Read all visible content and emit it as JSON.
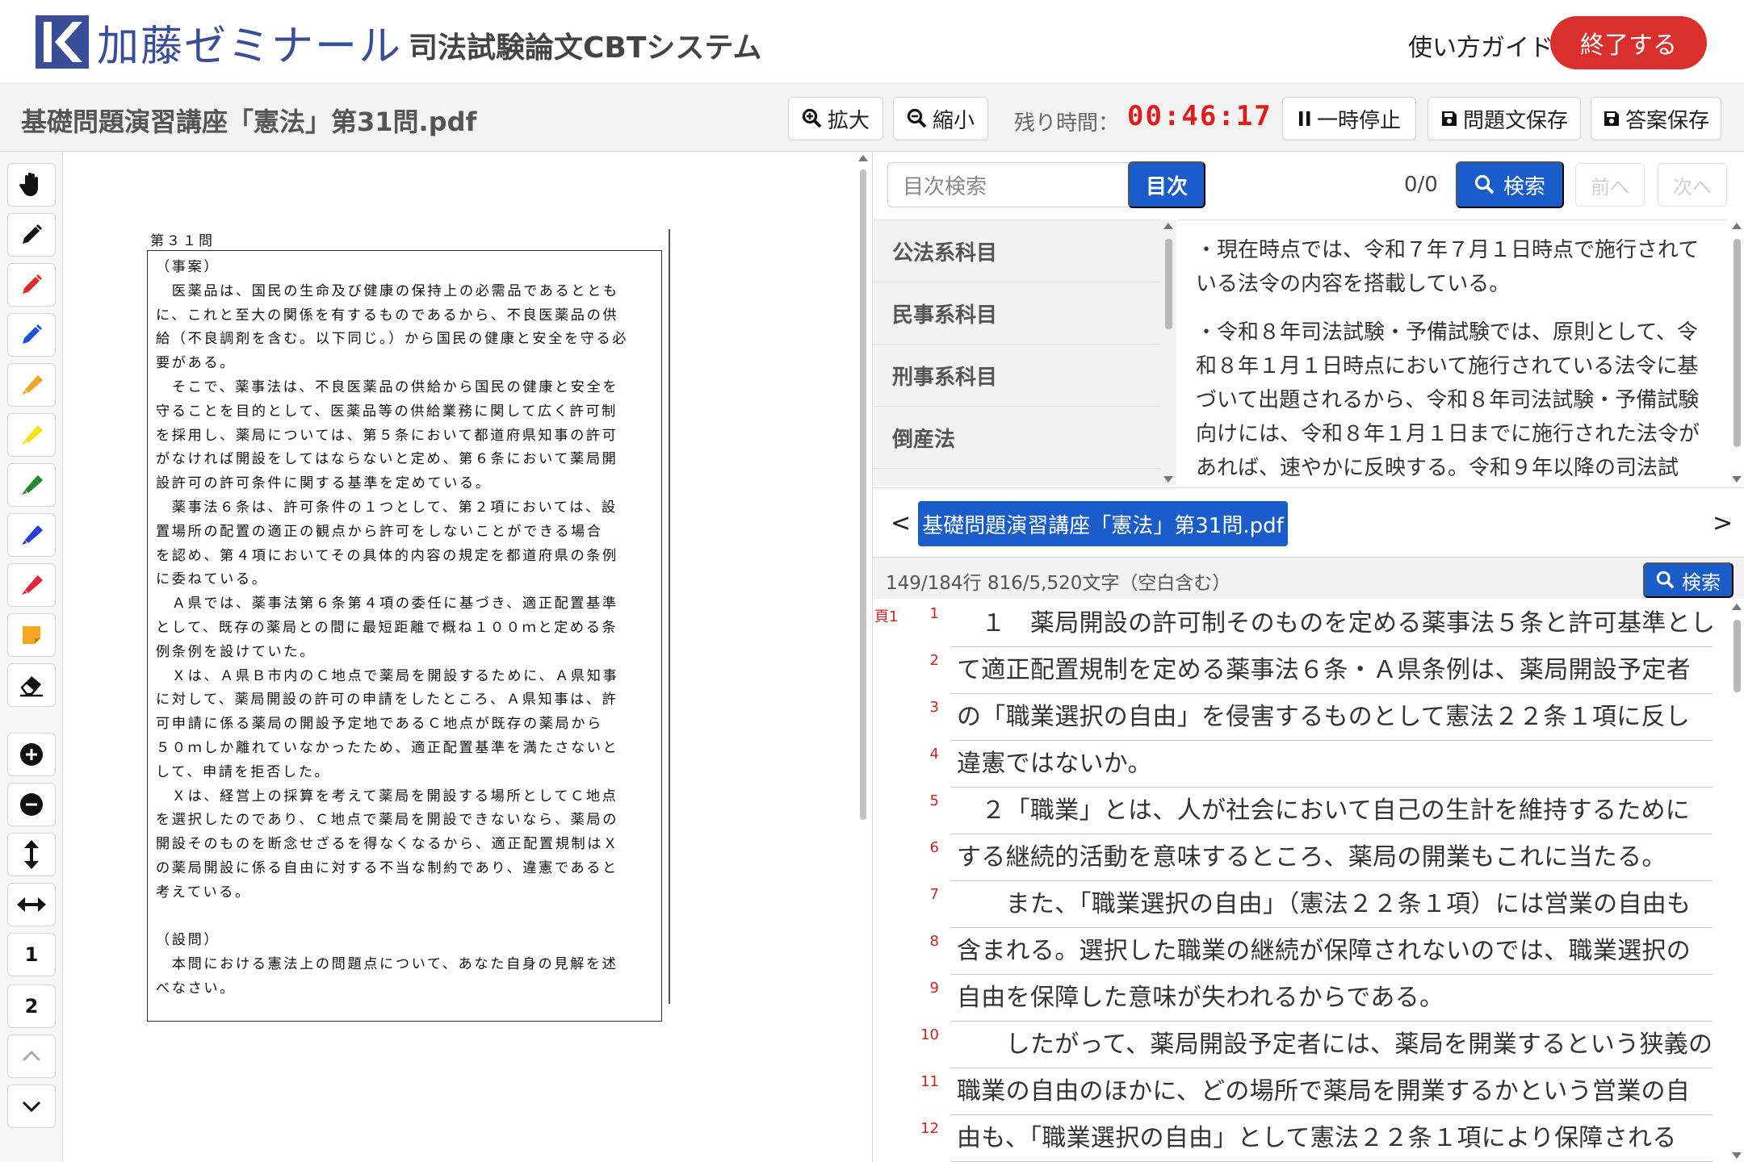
{
  "header": {
    "logo_text": "加藤ゼミナール",
    "system_title": "司法試験論文CBTシステム",
    "guide_label": "使い方ガイド",
    "exit_label": "終了する",
    "brand_color": "#3a4d99",
    "exit_color": "#d9302e"
  },
  "toolbar": {
    "doc_title": "基礎問題演習講座「憲法」第31問.pdf",
    "zoom_in_label": "拡大",
    "zoom_out_label": "縮小",
    "timer_label": "残り時間：",
    "timer_value": "00:46:17",
    "pause_label": "一時停止",
    "save_question_label": "問題文保存",
    "save_answer_label": "答案保存"
  },
  "tools": [
    {
      "icon": "hand-icon"
    },
    {
      "icon": "pen-black-icon",
      "color": "#111111"
    },
    {
      "icon": "pen-red-icon",
      "color": "#e02b2b"
    },
    {
      "icon": "pen-blue-icon",
      "color": "#1f4fd6"
    },
    {
      "icon": "highlighter-orange-icon",
      "color": "#f4a623"
    },
    {
      "icon": "highlighter-yellow-icon",
      "color": "#f2e218"
    },
    {
      "icon": "highlighter-green-icon",
      "color": "#1f8a2b"
    },
    {
      "icon": "highlighter-blue-icon",
      "color": "#1f3fd6"
    },
    {
      "icon": "highlighter-red-icon",
      "color": "#e0263b"
    },
    {
      "icon": "sticky-note-icon",
      "color": "#f5a623"
    },
    {
      "icon": "eraser-icon"
    },
    {
      "icon": "zoom-plus-icon"
    },
    {
      "icon": "zoom-minus-icon"
    },
    {
      "icon": "fit-height-icon"
    },
    {
      "icon": "fit-width-icon"
    },
    {
      "icon": "page-1",
      "label": "1"
    },
    {
      "icon": "page-2",
      "label": "2"
    },
    {
      "icon": "chevron-up-icon"
    },
    {
      "icon": "chevron-down-icon"
    }
  ],
  "pdf": {
    "question_no": "第３１問",
    "lines": [
      "（事案）",
      "　医薬品は、国民の生命及び健康の保持上の必需品であるととも",
      "に、これと至大の関係を有するものであるから、不良医薬品の供",
      "給（不良調剤を含む。以下同じ。）から国民の健康と安全を守る必",
      "要がある。",
      "　そこで、薬事法は、不良医薬品の供給から国民の健康と安全を",
      "守ることを目的として、医薬品等の供給業務に関して広く許可制",
      "を採用し、薬局については、第５条において都道府県知事の許可",
      "がなければ開設をしてはならないと定め、第６条において薬局開",
      "設許可の許可条件に関する基準を定めている。",
      "　薬事法６条は、許可条件の１つとして、第２項においては、設",
      "置場所の配置の適正の観点から許可をしないことができる場合",
      "を認め、第４項においてその具体的内容の規定を都道府県の条例",
      "に委ねている。",
      "　Ａ県では、薬事法第６条第４項の委任に基づき、適正配置基準",
      "として、既存の薬局との間に最短距離で概ね１００ｍと定める条",
      "例条例を設けていた。",
      "　Ｘは、Ａ県Ｂ市内のＣ地点で薬局を開設するために、Ａ県知事",
      "に対して、薬局開設の許可の申請をしたところ、Ａ県知事は、許",
      "可申請に係る薬局の開設予定地であるＣ地点が既存の薬局から",
      "５０ｍしか離れていなかったため、適正配置基準を満たさないと",
      "して、申請を拒否した。",
      "　Ｘは、経営上の採算を考えて薬局を開設する場所としてＣ地点",
      "を選択したのであり、Ｃ地点で薬局を開設できないなら、薬局の",
      "開設そのものを断念せざるを得なくなるから、適正配置規制はＸ",
      "の薬局開設に係る自由に対する不当な制約であり、違憲であると",
      "考えている。",
      "",
      "（設問）",
      "　本問における憲法上の問題点について、あなた自身の見解を述",
      "べなさい。"
    ]
  },
  "right": {
    "toc_search_placeholder": "目次検索",
    "toc_button": "目次",
    "hit_count": "0/0",
    "search_label": "検索",
    "prev_label": "前へ",
    "next_label": "次へ",
    "toc_items": [
      "公法系科目",
      "民事系科目",
      "刑事系科目",
      "倒産法"
    ],
    "notes": [
      "・現在時点では、令和７年７月１日時点で施行されている法令の内容を搭載している。",
      "・令和８年司法試験・予備試験では、原則として、令和８年１月１日時点において施行されている法令に基づいて出題されるから、令和８年司法試験・予備試験向けには、令和８年１月１日までに施行された法令があれば、速やかに反映する。令和９年以降の司法試"
    ],
    "file_tab": "基礎問題演習講座「憲法」第31問.pdf",
    "file_prev": "<",
    "file_next": ">",
    "answer_stats": "149/184行 816/5,520文字（空白含む）",
    "answer_search_label": "検索",
    "page_label": "頁1",
    "answer_lines": [
      {
        "num": "1",
        "text": "　１　薬局開設の許可制そのものを定める薬事法５条と許可基準とし"
      },
      {
        "num": "2",
        "text": "て適正配置規制を定める薬事法６条・Ａ県条例は、薬局開設予定者"
      },
      {
        "num": "3",
        "text": "の「職業選択の自由」を侵害するものとして憲法２２条１項に反し"
      },
      {
        "num": "4",
        "text": "違憲ではないか。"
      },
      {
        "num": "5",
        "text": "　２「職業」とは、人が社会において自己の生計を維持するために"
      },
      {
        "num": "6",
        "text": "する継続的活動を意味するところ、薬局の開業もこれに当たる。"
      },
      {
        "num": "7",
        "text": "　　また、「職業選択の自由」（憲法２２条１項）には営業の自由も"
      },
      {
        "num": "8",
        "text": "含まれる。選択した職業の継続が保障されないのでは、職業選択の"
      },
      {
        "num": "9",
        "text": "自由を保障した意味が失われるからである。"
      },
      {
        "num": "10",
        "text": "　　したがって、薬局開設予定者には、薬局を開業するという狭義の"
      },
      {
        "num": "11",
        "text": "職業の自由のほかに、どの場所で薬局を開業するかという営業の自"
      },
      {
        "num": "12",
        "text": "由も、「職業選択の自由」として憲法２２条１項により保障される"
      }
    ]
  }
}
